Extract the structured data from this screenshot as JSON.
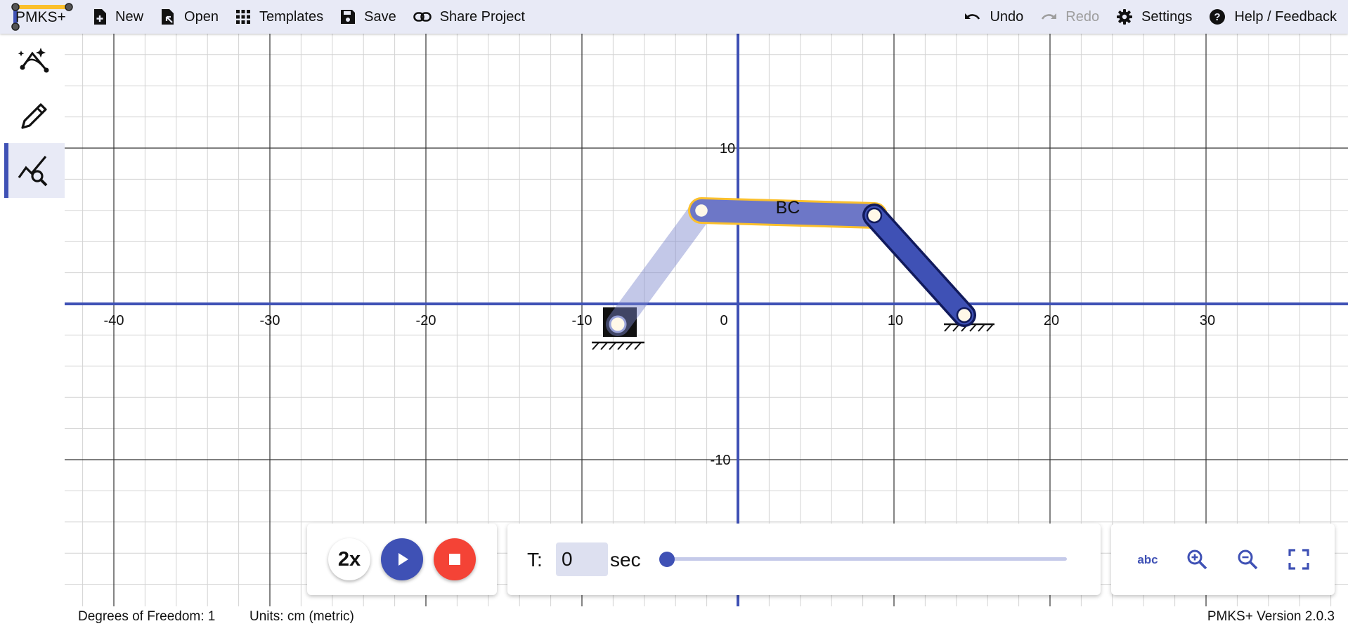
{
  "app": {
    "logo_text": "PMKS+",
    "brand_color": "#3f51b5",
    "highlight_color": "#fbc02d"
  },
  "toolbar": {
    "new_label": "New",
    "open_label": "Open",
    "templates_label": "Templates",
    "save_label": "Save",
    "share_label": "Share Project",
    "undo_label": "Undo",
    "redo_label": "Redo",
    "settings_label": "Settings",
    "help_label": "Help / Feedback"
  },
  "sidebar": {
    "items": [
      {
        "icon": "synthesis-icon",
        "active": false
      },
      {
        "icon": "pencil-icon",
        "active": false
      },
      {
        "icon": "analysis-icon",
        "active": true
      }
    ]
  },
  "canvas": {
    "x_ticks": [
      "-40",
      "-30",
      "-20",
      "-10",
      "0",
      "10",
      "20",
      "30"
    ],
    "y_ticks": [
      "10",
      "-10"
    ],
    "link_label": "BC",
    "selected_link_outline": "#fbc02d"
  },
  "animation": {
    "speed_label": "2x",
    "time_label": "T:",
    "time_value": "0",
    "time_unit": "sec",
    "progress": 0
  },
  "status": {
    "dof": "Degrees of Freedom: 1",
    "units": "Units: cm (metric)",
    "version": "PMKS+ Version 2.0.3"
  }
}
